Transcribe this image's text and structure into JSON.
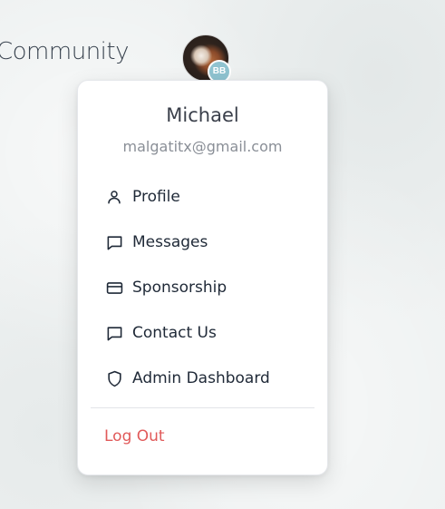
{
  "header": {
    "brand_text": "Community",
    "avatar_badge": "BB"
  },
  "user_menu": {
    "name": "Michael",
    "email": "malgatitx@gmail.com",
    "items": [
      {
        "label": "Profile",
        "icon": "user-icon"
      },
      {
        "label": "Messages",
        "icon": "message-icon"
      },
      {
        "label": "Sponsorship",
        "icon": "credit-card-icon"
      },
      {
        "label": "Contact Us",
        "icon": "message-icon"
      },
      {
        "label": "Admin Dashboard",
        "icon": "shield-icon"
      }
    ],
    "logout_label": "Log Out"
  },
  "colors": {
    "logout": "#e15a5a",
    "badge": "#8fc3d0"
  }
}
